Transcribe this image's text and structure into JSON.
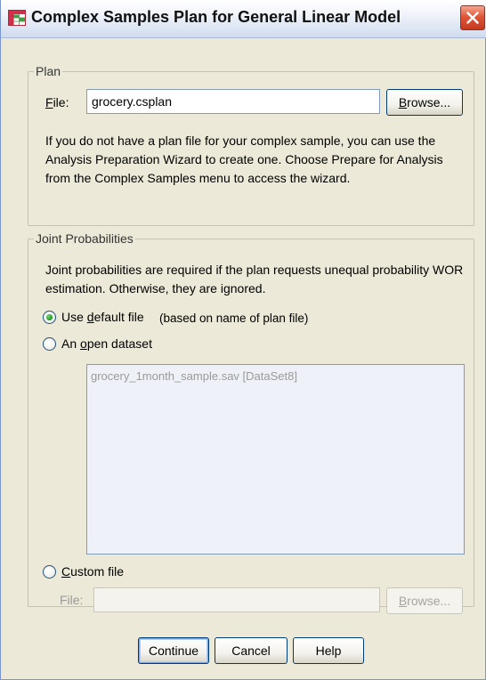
{
  "window": {
    "title": "Complex Samples Plan for General Linear Model",
    "icon": "table-icon",
    "close_icon": "close-icon"
  },
  "plan": {
    "group_label": "Plan",
    "file_label_prefix": "F",
    "file_label_rest": "ile:",
    "file_value": "grocery.csplan",
    "browse_u": "B",
    "browse_rest": "rowse...",
    "help_text": "If you do not have a plan file for your complex sample, you can use the Analysis Preparation Wizard to create one. Choose Prepare for Analysis from the Complex Samples menu to access the wizard."
  },
  "joint": {
    "group_label": "Joint Probabilities",
    "help_text": "Joint probabilities are required if the plan requests unequal probability WOR estimation. Otherwise, they are ignored.",
    "options": [
      {
        "pre": "Use ",
        "u": "d",
        "post": "efault file",
        "checked": true
      },
      {
        "pre": "An ",
        "u": "o",
        "post": "pen dataset",
        "checked": false
      },
      {
        "pre": "",
        "u": "C",
        "post": "ustom file",
        "checked": false
      }
    ],
    "default_note": "(based on name of plan file)",
    "datasets": [
      "grocery_1month_sample.sav [DataSet8]"
    ],
    "custom_file_label": "File:",
    "custom_file_value": "",
    "custom_browse_u": "B",
    "custom_browse_rest": "rowse..."
  },
  "buttons": {
    "continue": "Continue",
    "cancel": "Cancel",
    "help": "Help"
  },
  "colors": {
    "dialog_bg": "#ece9d8",
    "close_button": "#e0563a",
    "radio_selected": "#21a121"
  }
}
